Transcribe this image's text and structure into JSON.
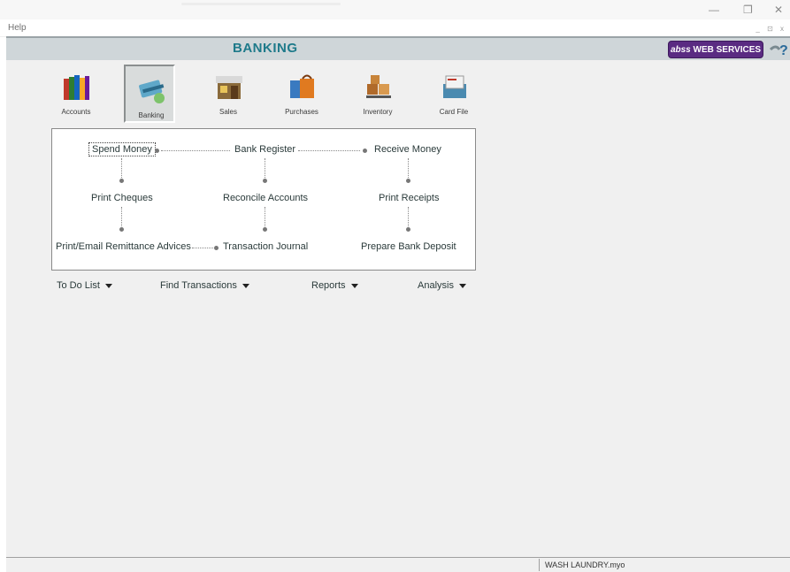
{
  "menu": {
    "help": "Help"
  },
  "window_controls": {
    "minimize": "—",
    "restore": "❐",
    "close": "✕",
    "mdi": "_ ⊡ x"
  },
  "header": {
    "title": "BANKING",
    "abss_italic": "abss",
    "abss_rest": " WEB SERVICES"
  },
  "modules": [
    {
      "label": "Accounts",
      "icon": "books-icon"
    },
    {
      "label": "Banking",
      "icon": "bank-card-icon",
      "active": true
    },
    {
      "label": "Sales",
      "icon": "shop-icon"
    },
    {
      "label": "Purchases",
      "icon": "shopping-bags-icon"
    },
    {
      "label": "Inventory",
      "icon": "boxes-trolley-icon"
    },
    {
      "label": "Card File",
      "icon": "card-file-icon"
    }
  ],
  "flow": {
    "spend_money": "Spend Money",
    "bank_register": "Bank Register",
    "receive_money": "Receive Money",
    "print_cheques": "Print Cheques",
    "reconcile_accounts": "Reconcile Accounts",
    "print_receipts": "Print Receipts",
    "print_email_remittance": "Print/Email Remittance Advices",
    "transaction_journal": "Transaction Journal",
    "prepare_bank_deposit": "Prepare Bank Deposit"
  },
  "dropdowns": {
    "todo": "To Do List",
    "find": "Find Transactions",
    "reports": "Reports",
    "analysis": "Analysis"
  },
  "status": {
    "file": "WASH LAUNDRY.myo"
  }
}
